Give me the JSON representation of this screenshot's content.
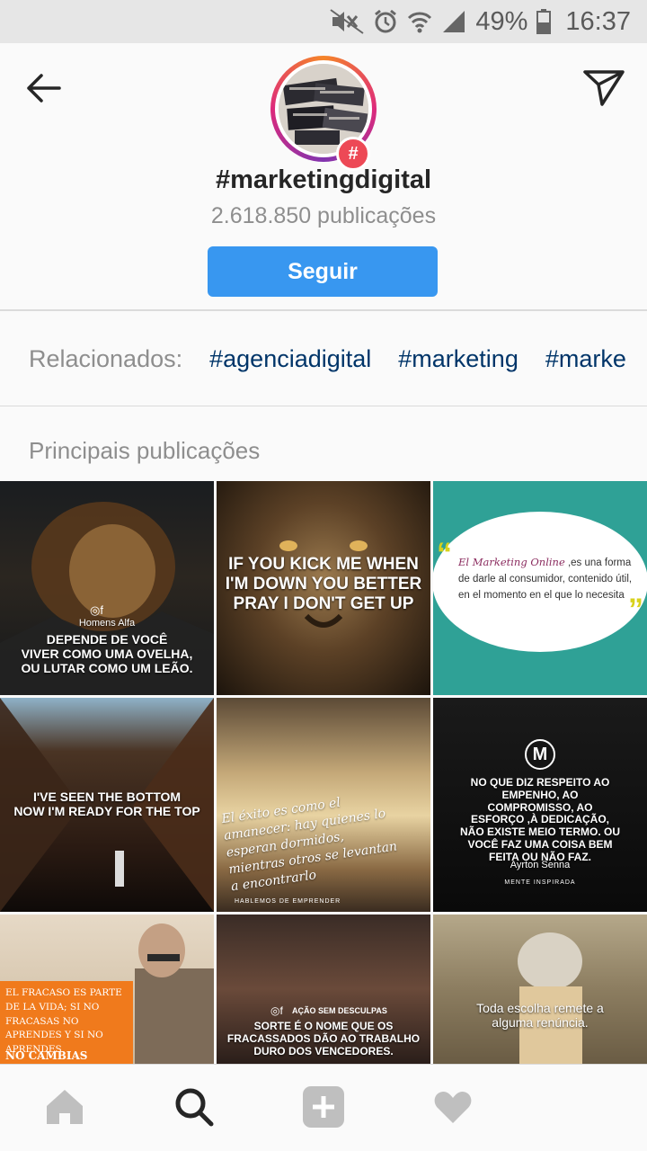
{
  "status_bar": {
    "battery": "49%",
    "time": "16:37"
  },
  "header": {
    "title": "#marketingdigital",
    "count": "2.618.850 publicações",
    "follow_label": "Seguir",
    "badge": "#"
  },
  "related": {
    "label": "Relacionados:",
    "tags": [
      "#agenciadigital",
      "#marketing",
      "#marke"
    ]
  },
  "section_title": "Principais publicações",
  "posts": [
    {
      "brand": "Homens Alfa",
      "text": "DEPENDE DE VOCÊ\nVIVER COMO UMA OVELHA,\nOU LUTAR COMO UM LEÃO."
    },
    {
      "text": "IF YOU KICK ME WHEN\nI'M DOWN YOU BETTER\nPRAY I DON'T GET UP"
    },
    {
      "text_a": "El Marketing Online",
      "text_b": ",es una forma de darle al consumidor, contenido útil, en el momento en el que lo necesita"
    },
    {
      "text": "I'VE SEEN THE BOTTOM\nNOW I'M READY FOR THE TOP"
    },
    {
      "text": "El éxito es como el amanecer: hay quienes lo esperan dormidos, mientras otros se levantan a encontrarlo",
      "footer": "HABLEMOS DE EMPRENDER"
    },
    {
      "text": "NO QUE DIZ RESPEITO AO EMPENHO, AO COMPROMISSO, AO ESFORÇO ,À DEDICAÇÃO, NÃO EXISTE MEIO TERMO. OU VOCÊ FAZ UMA COISA BEM FEITA OU NÃO FAZ.",
      "author": "Ayrton Senna",
      "footer": "MENTE INSPIRADA"
    },
    {
      "text": "EL FRACASO ES PARTE DE LA VIDA; SI NO FRACASAS NO APRENDES Y SI NO APRENDES",
      "highlight": "NO CAMBIAS"
    },
    {
      "brand": "AÇÃO SEM DESCULPAS",
      "text": "SORTE É O NOME QUE OS FRACASSADOS DÃO AO TRABALHO DURO DOS VENCEDORES."
    },
    {
      "text": "Toda escolha remete a alguma renúncia."
    }
  ],
  "nav": [
    "home-icon",
    "search-icon",
    "add-icon",
    "heart-icon"
  ]
}
